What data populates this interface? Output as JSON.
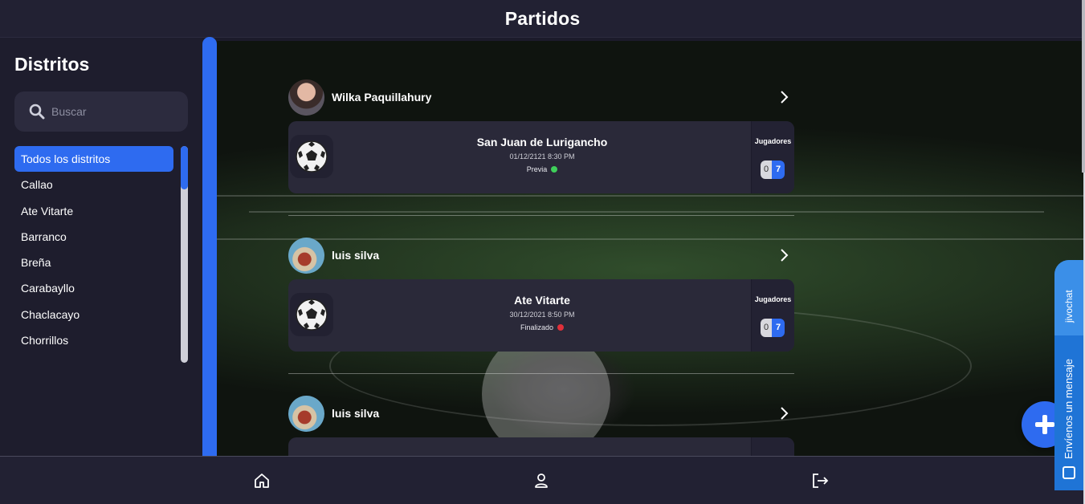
{
  "header": {
    "title": "Partidos"
  },
  "sidebar": {
    "title": "Distritos",
    "search": {
      "placeholder": "Buscar",
      "icon": "search-icon"
    },
    "items": [
      {
        "label": "Todos los distritos",
        "active": true
      },
      {
        "label": "Callao"
      },
      {
        "label": "Ate Vitarte"
      },
      {
        "label": "Barranco"
      },
      {
        "label": "Breña"
      },
      {
        "label": "Carabayllo"
      },
      {
        "label": "Chaclacayo"
      },
      {
        "label": "Chorrillos"
      }
    ]
  },
  "matches": [
    {
      "user": "Wilka Paquillahury",
      "district": "San Juan de Lurigancho",
      "datetime": "01/12/2121 8:30 PM",
      "status": "Previa",
      "status_color": "#3fcf5a",
      "players_label": "Jugadores",
      "players_joined": "0",
      "players_total": "7"
    },
    {
      "user": "luis silva",
      "district": "Ate Vitarte",
      "datetime": "30/12/2021 8:50 PM",
      "status": "Finalizado",
      "status_color": "#e0303a",
      "players_label": "Jugadores",
      "players_joined": "0",
      "players_total": "7"
    },
    {
      "user": "luis silva"
    }
  ],
  "bottom_nav": [
    {
      "icon": "home-icon"
    },
    {
      "icon": "user-icon"
    },
    {
      "icon": "logout-icon"
    }
  ],
  "chat_widget": {
    "brand": "jivochat",
    "cta": "Envíenos un mensaje"
  },
  "colors": {
    "accent": "#2e6bf0",
    "background": "#1c1b2b",
    "card": "#2a2939"
  }
}
